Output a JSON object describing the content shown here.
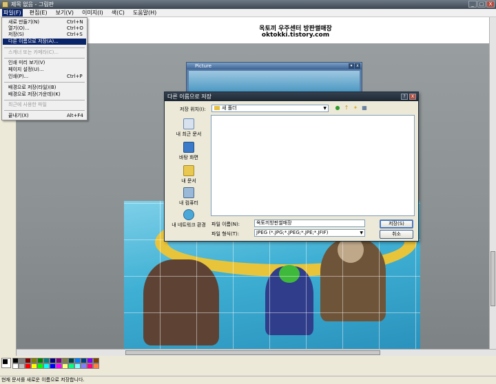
{
  "window": {
    "title": "제목 없음 - 그림판"
  },
  "menubar": {
    "items": [
      "파일(F)",
      "편집(E)",
      "보기(V)",
      "이미지(I)",
      "색(C)",
      "도움말(H)"
    ]
  },
  "file_menu": {
    "items": [
      {
        "label": "새로 만들기(N)",
        "shortcut": "Ctrl+N"
      },
      {
        "label": "열기(O)...",
        "shortcut": "Ctrl+O"
      },
      {
        "label": "저장(S)",
        "shortcut": "Ctrl+S"
      },
      {
        "label": "다른 이름으로 저장(A)...",
        "shortcut": ""
      },
      {
        "label": "스캐너 또는 카메라(C)...",
        "shortcut": ""
      },
      {
        "label": "인쇄 미리 보기(V)",
        "shortcut": ""
      },
      {
        "label": "페이지 설정(U)...",
        "shortcut": ""
      },
      {
        "label": "인쇄(P)...",
        "shortcut": "Ctrl+P"
      },
      {
        "label": "배경으로 저장(타일)(B)",
        "shortcut": ""
      },
      {
        "label": "배경으로 저장(가운데)(K)",
        "shortcut": ""
      },
      {
        "label": "최근에 사용한 파일",
        "shortcut": ""
      },
      {
        "label": "끝내기(X)",
        "shortcut": "Alt+F4"
      }
    ]
  },
  "canvas": {
    "line1": "옥토끼 우주센터 방판썰매장",
    "line2": "oktokki.tistory.com"
  },
  "picture_window": {
    "title": "Picture"
  },
  "dialog": {
    "title": "다른 이름으로 저장",
    "look_in_label": "저장 위치(I):",
    "look_in_value": "새 폴더",
    "places": [
      "내 최근 문서",
      "바탕 화면",
      "내 문서",
      "내 컴퓨터",
      "내 네트워크 환경"
    ],
    "filename_label": "파일 이름(N):",
    "filename_value": "옥토끼방판썰매장",
    "filetype_label": "파일 형식(T):",
    "filetype_value": "JPEG (*.JPG;*.JPEG;*.JPE;*.JFIF)",
    "save_button": "저장(S)",
    "cancel_button": "취소"
  },
  "palette": {
    "colors": [
      "#000000",
      "#808080",
      "#800000",
      "#808000",
      "#008000",
      "#008080",
      "#000080",
      "#800080",
      "#808040",
      "#004040",
      "#0080ff",
      "#004080",
      "#8000ff",
      "#804000",
      "#ffffff",
      "#c0c0c0",
      "#ff0000",
      "#ffff00",
      "#00ff00",
      "#00ffff",
      "#0000ff",
      "#ff00ff",
      "#ffff80",
      "#00ff80",
      "#80ffff",
      "#8080ff",
      "#ff0080",
      "#ff8040"
    ]
  },
  "status": {
    "text": "현재 문서를 새로운 이름으로 저장합니다."
  },
  "window_buttons": {
    "minimize": "_",
    "maximize": "□",
    "close": "X"
  }
}
